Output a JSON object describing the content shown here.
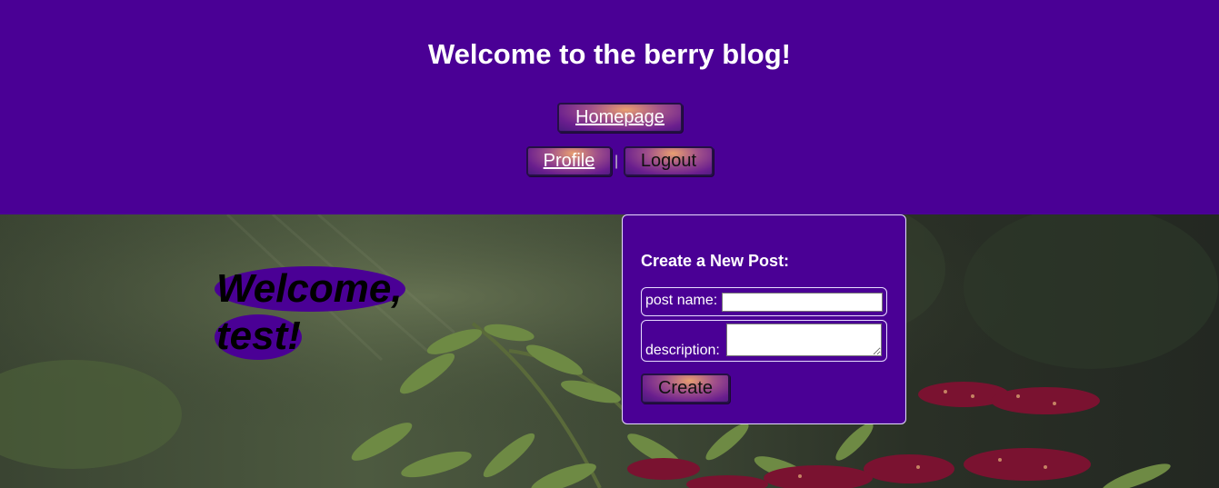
{
  "header": {
    "title": "Welcome to the berry blog!",
    "nav": {
      "homepage": "Homepage",
      "profile": "Profile",
      "separator": "|",
      "logout": "Logout"
    }
  },
  "welcome": {
    "line1": "Welcome,",
    "line2": "test!"
  },
  "new_post": {
    "title": "Create a New Post:",
    "post_name_label": "post name:",
    "post_name_value": "",
    "description_label": "description:",
    "description_value": "",
    "create_label": "Create"
  },
  "colors": {
    "brand_purple": "#4a0095",
    "text_white": "#ffffff",
    "button_glow": "#e8a070"
  }
}
